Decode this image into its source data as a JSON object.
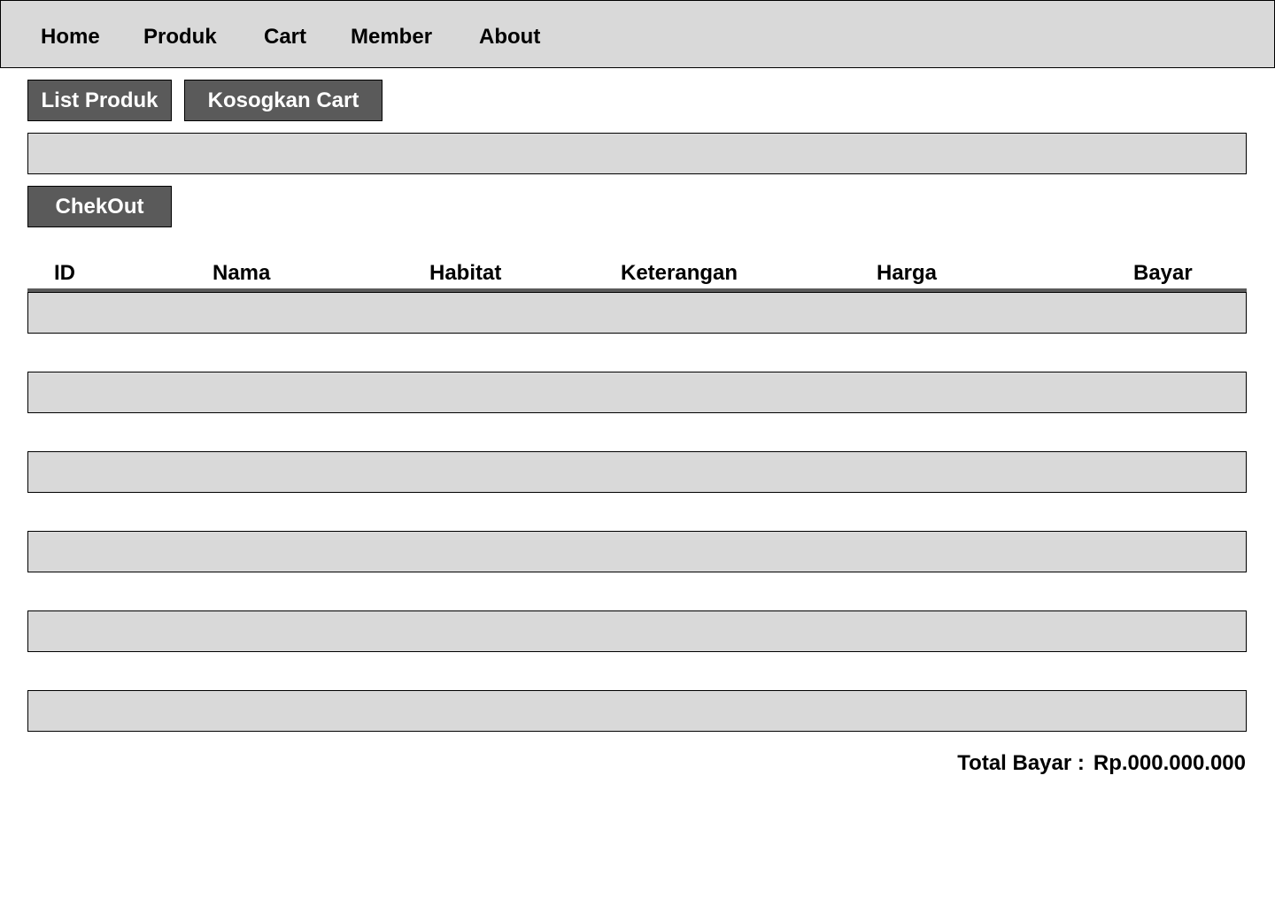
{
  "nav": {
    "items": [
      {
        "label": "Home"
      },
      {
        "label": "Produk"
      },
      {
        "label": "Cart"
      },
      {
        "label": "Member"
      },
      {
        "label": "About"
      }
    ]
  },
  "actions": {
    "list_produk_label": "List Produk",
    "kosongkan_cart_label": "Kosogkan Cart",
    "checkout_label": "ChekOut"
  },
  "table": {
    "columns": [
      "ID",
      "Nama",
      "Habitat",
      "Keterangan",
      "Harga",
      "Bayar"
    ],
    "rows": [
      "",
      "",
      "",
      "",
      "",
      ""
    ]
  },
  "summary": {
    "total_label": "Total Bayar :",
    "total_value": "Rp.000.000.000"
  },
  "colors": {
    "nav_bg": "#d9d9d9",
    "button_bg": "#5a5a5a",
    "button_text": "#ffffff",
    "row_bg": "#d9d9d9",
    "border": "#000000"
  }
}
